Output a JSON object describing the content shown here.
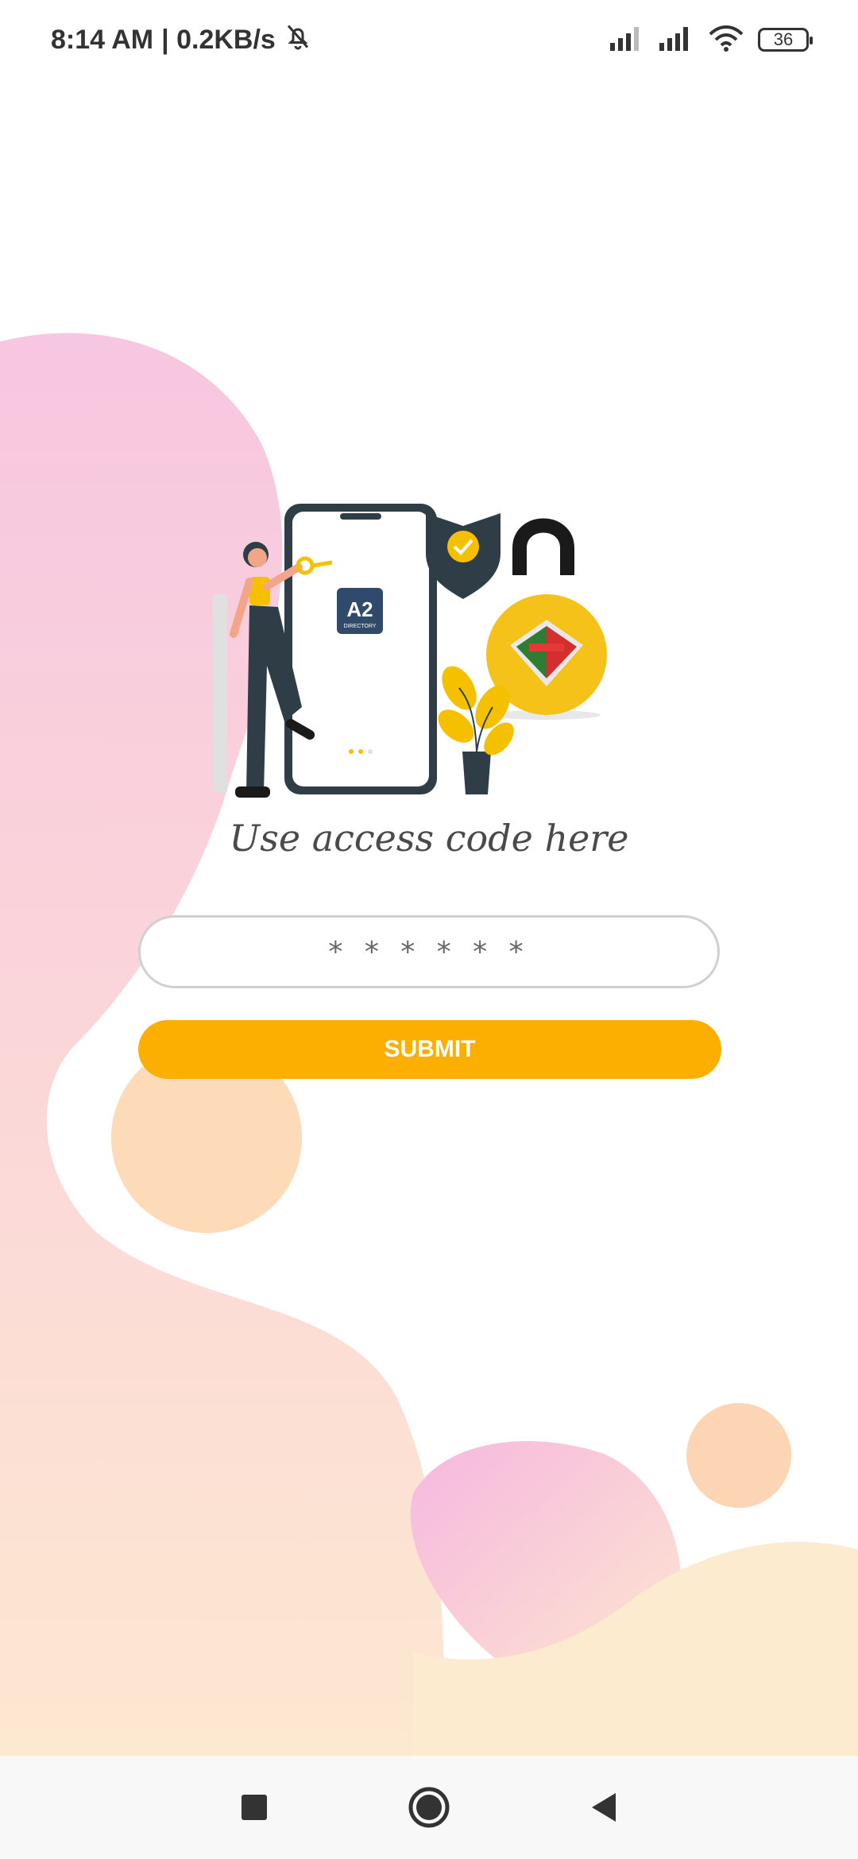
{
  "status_bar": {
    "time": "8:14 AM",
    "speed": "| 0.2KB/s",
    "battery": "36",
    "icons": [
      "bell-off-icon",
      "signal-icon",
      "signal-icon",
      "wifi-icon",
      "battery-icon"
    ]
  },
  "illustration": {
    "logo_text": "A2",
    "logo_subtext": "DIRECTORY",
    "icons": [
      "phone-icon",
      "shield-check-icon",
      "padlock-icon",
      "plant-icon",
      "key-icon",
      "person-icon"
    ]
  },
  "login": {
    "headline": "Use access code here",
    "code_placeholder": "* * * * * *",
    "submit_label": "SUBMIT"
  },
  "nav_bar": {
    "icons": [
      "recents-square-icon",
      "home-circle-icon",
      "back-triangle-icon"
    ]
  },
  "colors": {
    "accent": "#fdaf00",
    "pink": "#f6c4e3",
    "peach": "#fdd9b0",
    "dark": "#2f3e46"
  }
}
